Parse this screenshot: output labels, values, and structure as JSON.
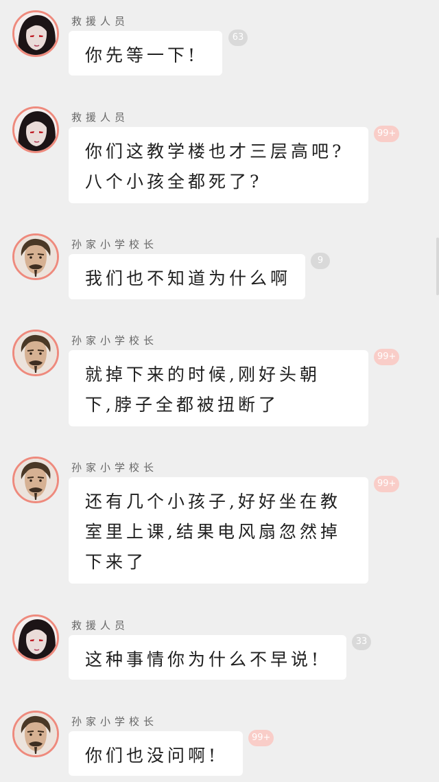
{
  "colors": {
    "background": "#efefef",
    "bubble": "#ffffff",
    "avatar_border": "#ee8a7d",
    "badge_grey": "#d9d9d9",
    "badge_pink": "#f9cdc8"
  },
  "messages": [
    {
      "sender": "救援人员",
      "avatar_icon": "rescuer-avatar-icon",
      "lines": [
        "你先等一下!"
      ],
      "badge": "63",
      "badge_style": "grey"
    },
    {
      "sender": "救援人员",
      "avatar_icon": "rescuer-avatar-icon",
      "lines": [
        "你们这教学楼也才三层高吧?",
        "八个小孩全都死了?"
      ],
      "badge": "99+",
      "badge_style": "pink"
    },
    {
      "sender": "孙家小学校长",
      "avatar_icon": "principal-avatar-icon",
      "lines": [
        "我们也不知道为什么啊"
      ],
      "badge": "9",
      "badge_style": "grey"
    },
    {
      "sender": "孙家小学校长",
      "avatar_icon": "principal-avatar-icon",
      "lines": [
        "就掉下来的时候,刚好头朝",
        "下,脖子全都被扭断了"
      ],
      "badge": "99+",
      "badge_style": "pink"
    },
    {
      "sender": "孙家小学校长",
      "avatar_icon": "principal-avatar-icon",
      "lines": [
        "还有几个小孩子,好好坐在教",
        "室里上课,结果电风扇忽然掉",
        "下来了"
      ],
      "badge": "99+",
      "badge_style": "pink"
    },
    {
      "sender": "救援人员",
      "avatar_icon": "rescuer-avatar-icon",
      "lines": [
        "这种事情你为什么不早说!"
      ],
      "badge": "33",
      "badge_style": "grey"
    },
    {
      "sender": "孙家小学校长",
      "avatar_icon": "principal-avatar-icon",
      "lines": [
        "你们也没问啊!"
      ],
      "badge": "99+",
      "badge_style": "pink"
    }
  ]
}
